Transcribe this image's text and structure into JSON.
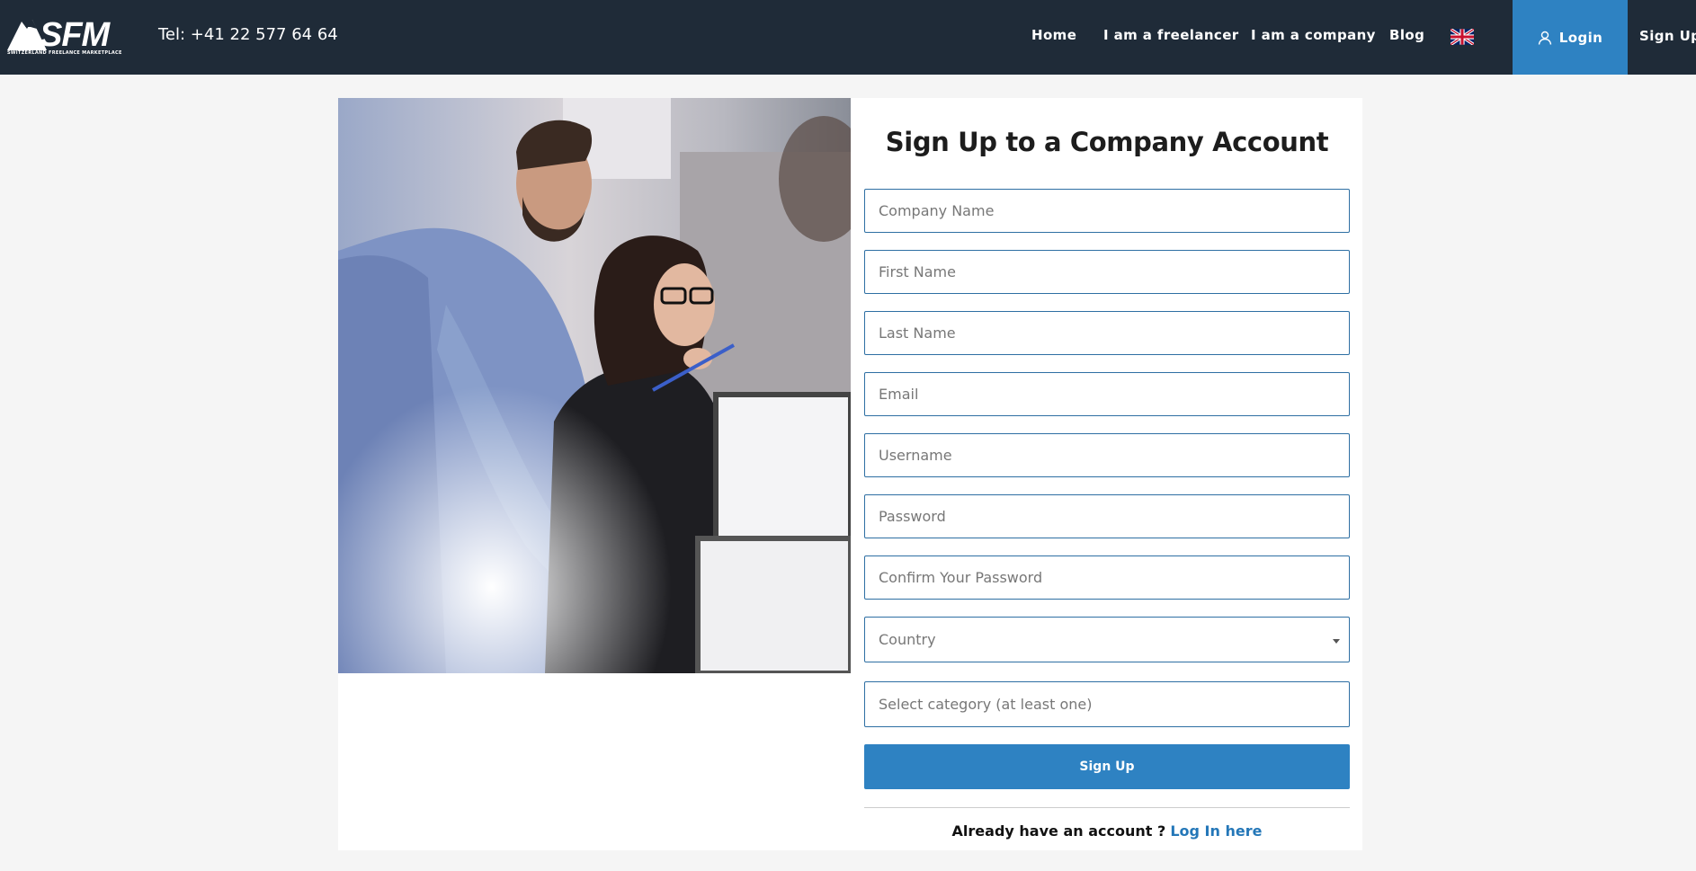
{
  "header": {
    "logo_text": "SFM",
    "logo_subtitle": "SWITZERLAND FREELANCE MARKETPLACE",
    "tel": "Tel: +41 22 577 64 64",
    "nav": {
      "home": "Home",
      "freelancer": "I am a freelancer",
      "company": "I am a company",
      "blog": "Blog"
    },
    "language_icon": "uk-flag-icon",
    "login_label": "Login",
    "signup_label": "Sign Up"
  },
  "form": {
    "title": "Sign Up to a Company Account",
    "company_name_placeholder": "Company Name",
    "first_name_placeholder": "First Name",
    "last_name_placeholder": "Last Name",
    "email_placeholder": "Email",
    "username_placeholder": "Username",
    "password_placeholder": "Password",
    "confirm_password_placeholder": "Confirm Your Password",
    "country_placeholder": "Country",
    "category_placeholder": "Select category (at least one)",
    "submit_label": "Sign Up",
    "already_text": "Already have an account ?",
    "login_link": "Log In here"
  },
  "colors": {
    "header_bg": "#1f2b38",
    "accent": "#2e82c2",
    "link": "#2477b8"
  }
}
